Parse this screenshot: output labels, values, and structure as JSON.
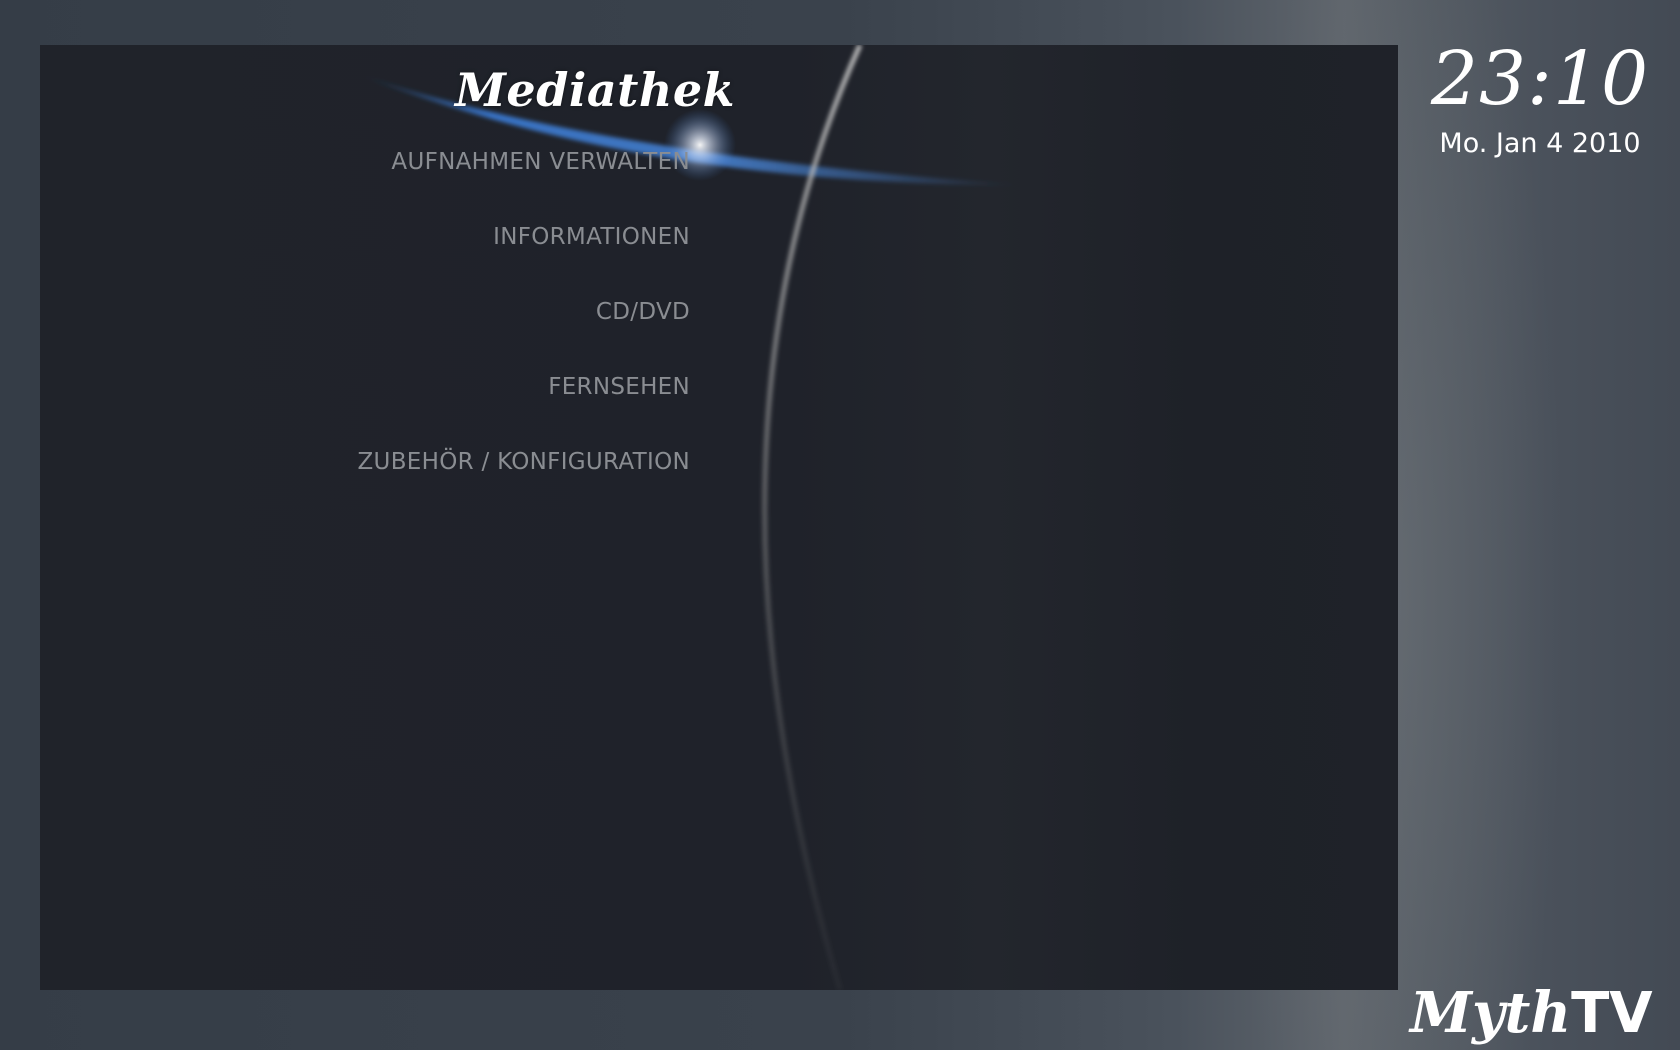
{
  "menu": {
    "title": "Mediathek",
    "items": [
      {
        "label": "AUFNAHMEN VERWALTEN"
      },
      {
        "label": "INFORMATIONEN"
      },
      {
        "label": "CD/DVD"
      },
      {
        "label": "FERNSEHEN"
      },
      {
        "label": "ZUBEHÖR / KONFIGURATION"
      }
    ]
  },
  "clock": {
    "time": "23:10",
    "date": "Mo. Jan 4 2010"
  },
  "logo": {
    "part1": "Myth",
    "part2": "TV"
  },
  "colors": {
    "accent": "#3a7bd5",
    "menu_text": "#8a8d92",
    "panel": "#1f222a"
  }
}
